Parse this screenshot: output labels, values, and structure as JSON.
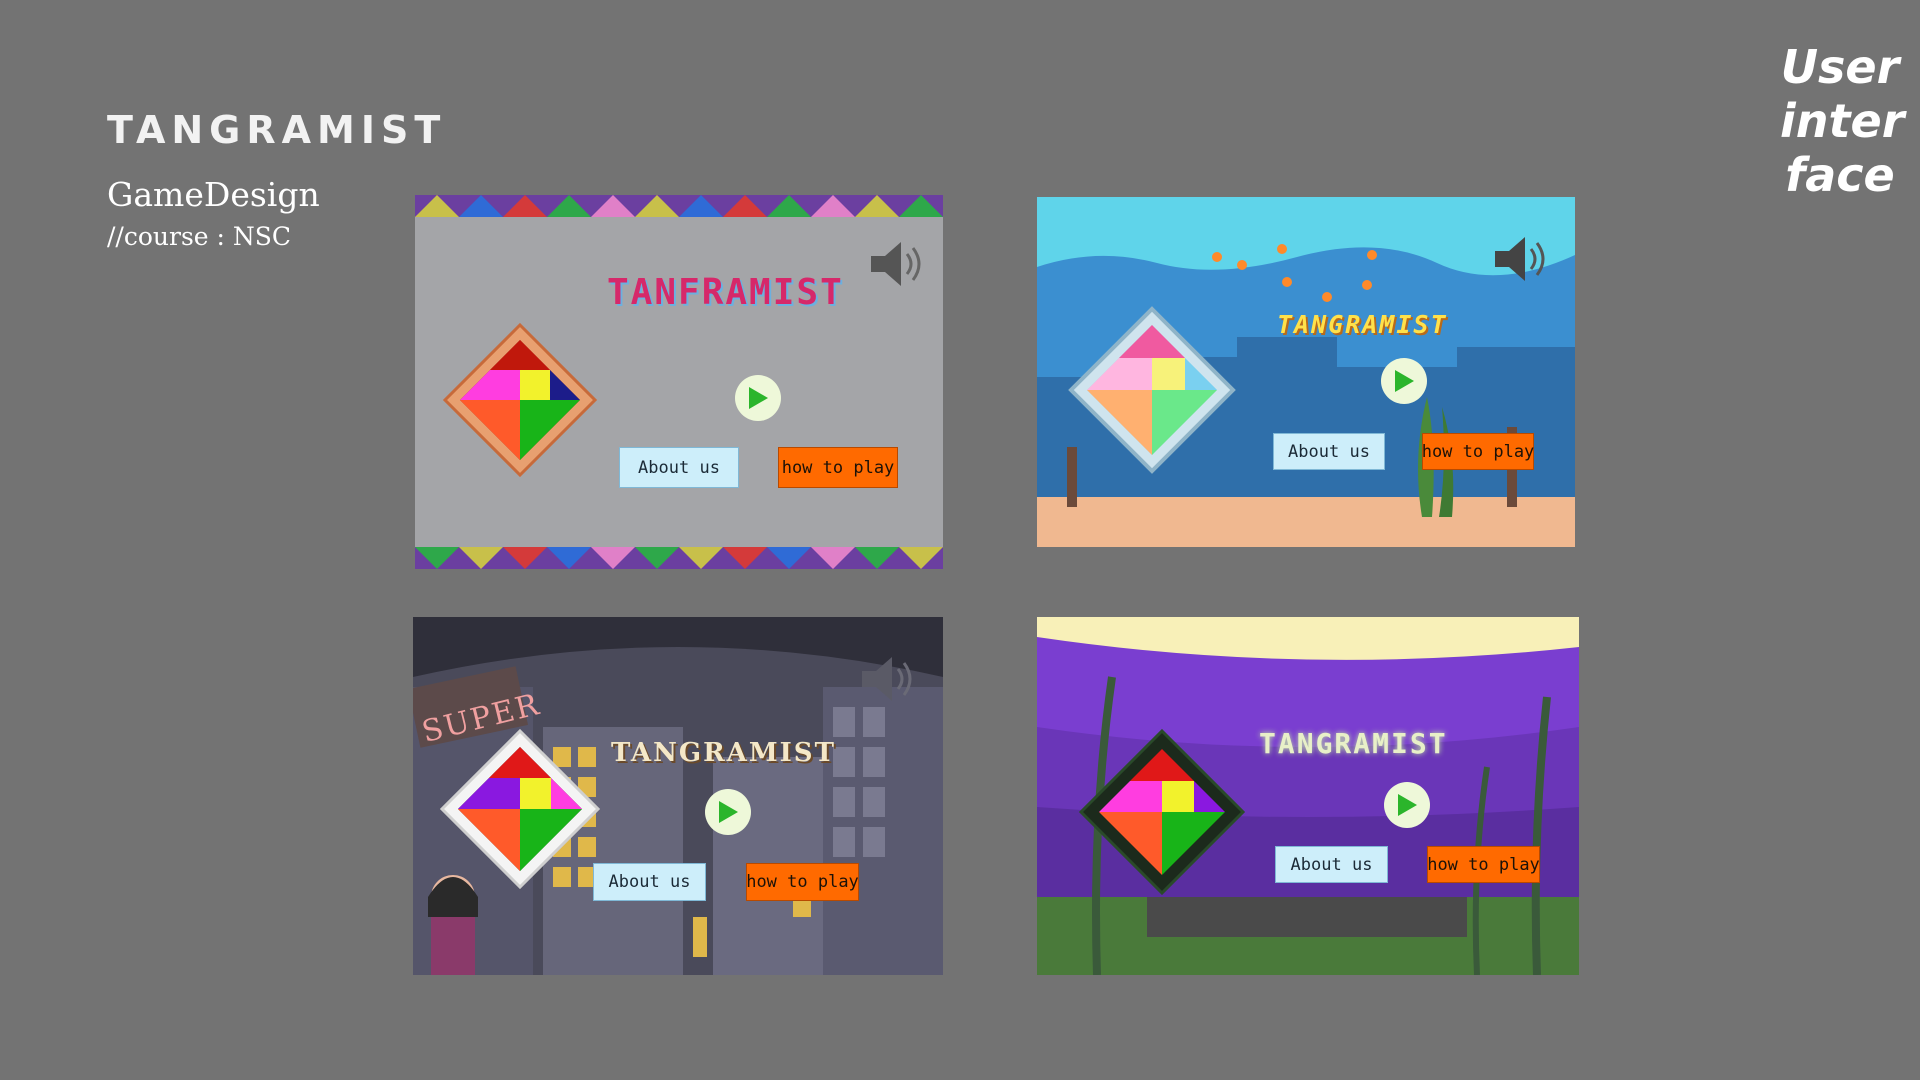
{
  "header": {
    "title": "TANGRAMIST",
    "subtitle": "GameDesign",
    "course": "//course : NSC",
    "corner_label": [
      "User",
      "inter",
      "face"
    ]
  },
  "screens": [
    {
      "theme": "pattern-border",
      "game_title": "TANFRAMIST",
      "about_label": "About us",
      "howto_label": "how to play"
    },
    {
      "theme": "underwater",
      "game_title": "TANGRAMIST",
      "about_label": "About us",
      "howto_label": "how to play"
    },
    {
      "theme": "city-night",
      "game_title": "TANGRAMIST",
      "about_label": "About us",
      "howto_label": "how to play",
      "sign_text": "SUPER"
    },
    {
      "theme": "purple-forest",
      "game_title": "TANGRAMIST",
      "about_label": "About us",
      "howto_label": "how to play"
    }
  ],
  "icons": {
    "sound": "speaker-icon",
    "play": "play-icon",
    "logo": "tangram-logo"
  },
  "colors": {
    "background": "#737373",
    "about_button": "#cdeefa",
    "howto_button": "#ff6a00",
    "play_arrow": "#2bb52b"
  }
}
